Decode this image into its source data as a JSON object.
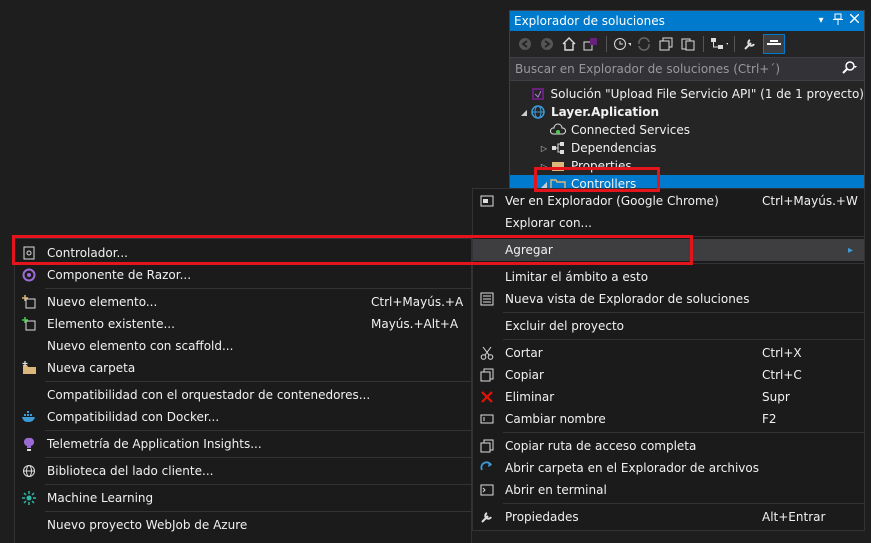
{
  "solution_explorer": {
    "title": "Explorador de soluciones",
    "pin_label": "▾",
    "search_placeholder": "Buscar en Explorador de soluciones (Ctrl+´)",
    "tree": [
      {
        "label": "Solución \"Upload File Servicio API\" (1 de 1 proyecto)",
        "icon": "solution-icon",
        "level": 0
      },
      {
        "label": "Layer.Aplication",
        "icon": "web-project-icon",
        "level": 1,
        "bold": true
      },
      {
        "label": "Connected Services",
        "icon": "connected-services-icon",
        "level": 2
      },
      {
        "label": "Dependencias",
        "icon": "dependencies-icon",
        "level": 2
      },
      {
        "label": "Properties",
        "icon": "properties-icon",
        "level": 2
      },
      {
        "label": "Controllers",
        "icon": "folder-icon",
        "level": 2,
        "selected": true
      }
    ]
  },
  "context_menu": {
    "items": [
      {
        "label": "Ver en Explorador (Google Chrome)",
        "shortcut": "Ctrl+Mayús.+W",
        "icon": "browser-icon"
      },
      {
        "label": "Explorar con...",
        "shortcut": "",
        "icon": ""
      },
      {
        "label": "Agregar",
        "shortcut": "",
        "icon": "",
        "submenu": "▸"
      },
      {
        "label": "Limitar el ámbito a esto",
        "shortcut": "",
        "icon": ""
      },
      {
        "label": "Nueva vista de Explorador de soluciones",
        "shortcut": "",
        "icon": "new-view-icon"
      },
      {
        "label": "Excluir del proyecto",
        "shortcut": "",
        "icon": ""
      },
      {
        "label": "Cortar",
        "shortcut": "Ctrl+X",
        "icon": "scissors-icon"
      },
      {
        "label": "Copiar",
        "shortcut": "Ctrl+C",
        "icon": "copy-icon"
      },
      {
        "label": "Eliminar",
        "shortcut": "Supr",
        "icon": "delete-icon"
      },
      {
        "label": "Cambiar nombre",
        "shortcut": "F2",
        "icon": "rename-icon"
      },
      {
        "label": "Copiar ruta de acceso completa",
        "shortcut": "",
        "icon": "copy-path-icon"
      },
      {
        "label": "Abrir carpeta en el Explorador de archivos",
        "shortcut": "",
        "icon": "open-folder-icon"
      },
      {
        "label": "Abrir en terminal",
        "shortcut": "",
        "icon": "terminal-icon"
      },
      {
        "label": "Propiedades",
        "shortcut": "Alt+Entrar",
        "icon": "wrench-icon"
      }
    ]
  },
  "submenu": {
    "items": [
      {
        "label": "Controlador...",
        "shortcut": "",
        "icon": "controller-icon"
      },
      {
        "label": "Componente de Razor...",
        "shortcut": "",
        "icon": "razor-icon"
      },
      {
        "label": "Nuevo elemento...",
        "shortcut": "Ctrl+Mayús.+A",
        "icon": "new-item-icon"
      },
      {
        "label": "Elemento existente...",
        "shortcut": "Mayús.+Alt+A",
        "icon": "existing-item-icon"
      },
      {
        "label": "Nuevo elemento con scaffold...",
        "shortcut": "",
        "icon": ""
      },
      {
        "label": "Nueva carpeta",
        "shortcut": "",
        "icon": "new-folder-icon"
      },
      {
        "label": "Compatibilidad con el orquestador de contenedores...",
        "shortcut": "",
        "icon": ""
      },
      {
        "label": "Compatibilidad con Docker...",
        "shortcut": "",
        "icon": "docker-icon"
      },
      {
        "label": "Telemetría de Application Insights...",
        "shortcut": "",
        "icon": "insights-icon"
      },
      {
        "label": "Biblioteca del lado cliente...",
        "shortcut": "",
        "icon": "library-icon"
      },
      {
        "label": "Machine Learning",
        "shortcut": "",
        "icon": "ml-icon"
      },
      {
        "label": "Nuevo proyecto WebJob de Azure",
        "shortcut": "",
        "icon": ""
      }
    ]
  }
}
